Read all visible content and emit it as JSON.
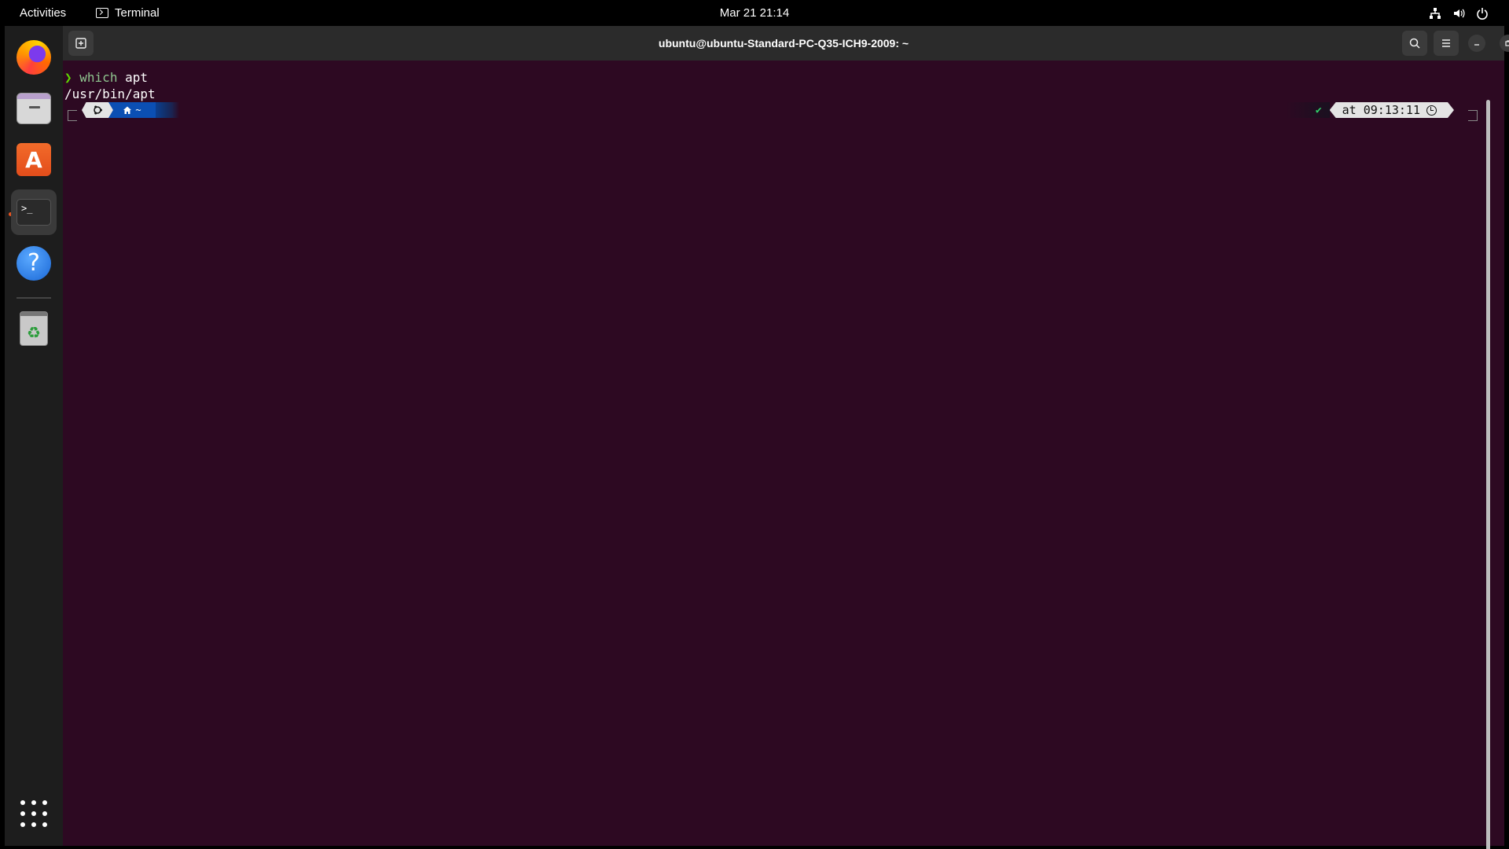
{
  "topbar": {
    "activities_label": "Activities",
    "app_label": "Terminal",
    "datetime": "Mar 21  21:14",
    "tray_icons": [
      "network-icon",
      "volume-icon",
      "power-icon"
    ]
  },
  "dock": {
    "items": [
      {
        "name": "firefox",
        "icon": "firefox-icon"
      },
      {
        "name": "files",
        "icon": "files-icon"
      },
      {
        "name": "app-center",
        "icon": "app-store-icon",
        "glyph": "A"
      },
      {
        "name": "terminal",
        "icon": "terminal-icon",
        "glyph": ">_",
        "active": true
      },
      {
        "name": "help",
        "icon": "help-icon",
        "glyph": "?"
      },
      {
        "name": "trash",
        "icon": "trash-icon",
        "glyph": "♻"
      }
    ],
    "show_apps_icon": "app-grid-icon"
  },
  "window": {
    "title": "ubuntu@ubuntu-Standard-PC-Q35-ICH9-2009: ~",
    "background": "#2d0922"
  },
  "terminal": {
    "prompt_char": "❯",
    "command_name": "which",
    "command_args": " apt",
    "output": "/usr/bin/apt",
    "prompt_dir": "~",
    "status_ok": "✔",
    "status_time": "at 09:13:11"
  }
}
